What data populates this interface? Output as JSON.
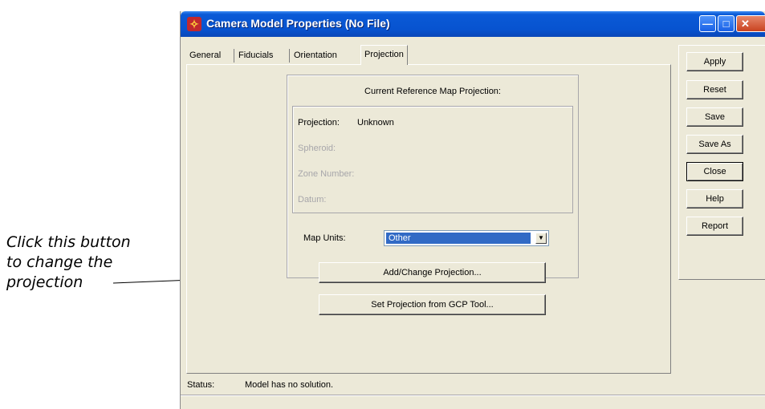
{
  "annotation": {
    "line1": "Click this button",
    "line2": "to change the",
    "line3": "projection"
  },
  "window": {
    "title": "Camera Model Properties (No File)",
    "icon": "app-logo-icon",
    "titlebar_buttons": [
      "minimize",
      "maximize",
      "close"
    ]
  },
  "tabs": [
    {
      "label": "General"
    },
    {
      "label": "Fiducials"
    },
    {
      "label": "Orientation"
    },
    {
      "label": "Projection",
      "active": true
    }
  ],
  "projection_panel": {
    "group_title": "Current Reference Map Projection:",
    "fields": [
      {
        "label": "Projection:",
        "value": "Unknown",
        "enabled": true
      },
      {
        "label": "Spheroid:",
        "value": "",
        "enabled": false
      },
      {
        "label": "Zone Number:",
        "value": "",
        "enabled": false
      },
      {
        "label": "Datum:",
        "value": "",
        "enabled": false
      }
    ],
    "map_units": {
      "label": "Map Units:",
      "selected": "Other"
    },
    "add_change_button": "Add/Change Projection...",
    "set_from_gcp_button": "Set Projection from GCP Tool..."
  },
  "side_buttons": [
    {
      "label": "Apply"
    },
    {
      "label": "Reset"
    },
    {
      "label": "Save"
    },
    {
      "label": "Save As"
    },
    {
      "label": "Close",
      "default": true
    },
    {
      "label": "Help"
    },
    {
      "label": "Report"
    }
  ],
  "status": {
    "label": "Status:",
    "text": "Model has no solution."
  },
  "colors": {
    "titlebar": "#0753d0",
    "dialog_bg": "#ece9d8",
    "selection": "#316ac5",
    "disabled_text": "#a7a6aa"
  }
}
